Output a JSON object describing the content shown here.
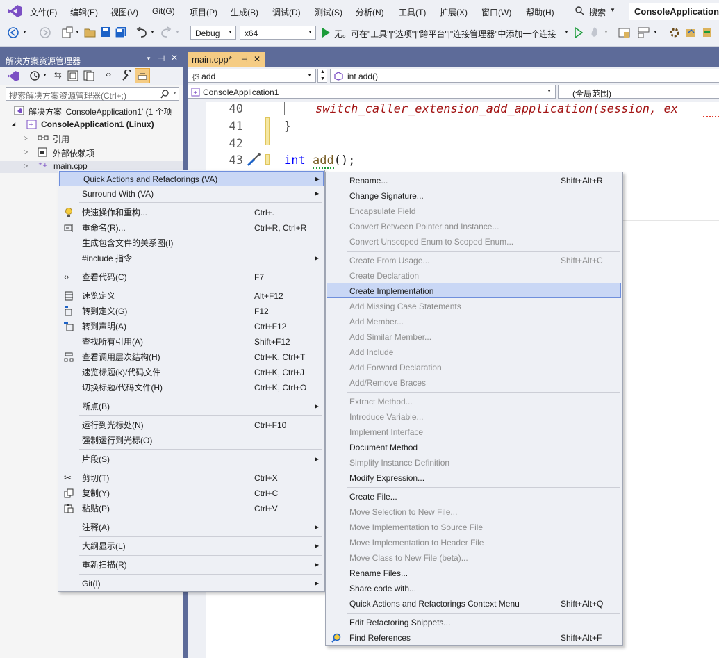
{
  "colors": {
    "accent": "#5d6b99",
    "tab_active": "#f5cc84",
    "menu_bg": "#eef0f5",
    "highlight": "#c9d7f5",
    "disabled_text": "#8d8d8d"
  },
  "menubar": {
    "items": [
      "文件(F)",
      "编辑(E)",
      "视图(V)",
      "Git(G)",
      "项目(P)",
      "生成(B)",
      "调试(D)",
      "测试(S)",
      "分析(N)",
      "工具(T)",
      "扩展(X)",
      "窗口(W)",
      "帮助(H)"
    ],
    "search_label": "搜索",
    "app_title": "ConsoleApplication"
  },
  "toolbar": {
    "config": "Debug",
    "platform": "x64",
    "run_label": "无。可在\"工具\"|\"选项\"|\"跨平台\"|\"连接管理器\"中添加一个连接"
  },
  "solution_explorer": {
    "title": "解决方案资源管理器",
    "search_placeholder": "搜索解决方案资源管理器(Ctrl+;)",
    "tree": [
      {
        "label": "解决方案 'ConsoleApplication1' (1 个项",
        "icon": "solution-icon"
      },
      {
        "label": "ConsoleApplication1 (Linux)",
        "icon": "project-icon"
      },
      {
        "label": "引用",
        "icon": "references-icon"
      },
      {
        "label": "外部依赖项",
        "icon": "dependencies-icon"
      },
      {
        "label": "main.cpp",
        "icon": "cpp-file-icon"
      }
    ]
  },
  "editor": {
    "tab_label": "main.cpp*",
    "scope_function": "add",
    "scope_signature": "int add()",
    "project_combo": "ConsoleApplication1",
    "global_scope": "(全局范围)",
    "lines": [
      {
        "no": "40",
        "code": "switch_caller_extension_add_application(session, ex"
      },
      {
        "no": "41",
        "code": "}"
      },
      {
        "no": "42",
        "code": ""
      },
      {
        "no": "43",
        "keyword": "int",
        "ident": "add",
        "rest": "();"
      }
    ]
  },
  "context_menu": {
    "items": [
      {
        "label": "Quick Actions and Refactorings (VA)",
        "shortcut": "",
        "sub": true
      },
      {
        "label": "Surround With (VA)",
        "shortcut": "",
        "sub": true
      },
      {
        "label": "快速操作和重构...",
        "shortcut": "Ctrl+.",
        "icon": "lightbulb-icon"
      },
      {
        "label": "重命名(R)...",
        "shortcut": "Ctrl+R, Ctrl+R",
        "icon": "rename-icon"
      },
      {
        "label": "生成包含文件的关系图(I)",
        "shortcut": ""
      },
      {
        "label": "#include 指令",
        "shortcut": "",
        "sub": true
      },
      {
        "label": "查看代码(C)",
        "shortcut": "F7",
        "icon": "code-icon"
      },
      {
        "label": "速览定义",
        "shortcut": "Alt+F12",
        "icon": "peek-icon"
      },
      {
        "label": "转到定义(G)",
        "shortcut": "F12",
        "icon": "goto-definition-icon"
      },
      {
        "label": "转到声明(A)",
        "shortcut": "Ctrl+F12",
        "icon": "goto-declaration-icon"
      },
      {
        "label": "查找所有引用(A)",
        "shortcut": "Shift+F12"
      },
      {
        "label": "查看调用层次结构(H)",
        "shortcut": "Ctrl+K, Ctrl+T",
        "icon": "call-hierarchy-icon"
      },
      {
        "label": "速览标题(k)/代码文件",
        "shortcut": "Ctrl+K, Ctrl+J"
      },
      {
        "label": "切换标题/代码文件(H)",
        "shortcut": "Ctrl+K, Ctrl+O"
      },
      {
        "label": "断点(B)",
        "shortcut": "",
        "sub": true
      },
      {
        "label": "运行到光标处(N)",
        "shortcut": "Ctrl+F10"
      },
      {
        "label": "强制运行到光标(O)",
        "shortcut": ""
      },
      {
        "label": "片段(S)",
        "shortcut": "",
        "sub": true
      },
      {
        "label": "剪切(T)",
        "shortcut": "Ctrl+X",
        "icon": "scissors-icon"
      },
      {
        "label": "复制(Y)",
        "shortcut": "Ctrl+C",
        "icon": "copy-icon"
      },
      {
        "label": "粘贴(P)",
        "shortcut": "Ctrl+V",
        "icon": "paste-icon"
      },
      {
        "label": "注释(A)",
        "shortcut": "",
        "sub": true
      },
      {
        "label": "大纲显示(L)",
        "shortcut": "",
        "sub": true
      },
      {
        "label": "重新扫描(R)",
        "shortcut": "",
        "sub": true
      },
      {
        "label": "Git(I)",
        "shortcut": "",
        "sub": true
      }
    ]
  },
  "submenu": {
    "items": [
      {
        "label": "Rename...",
        "shortcut": "Shift+Alt+R",
        "enabled": true
      },
      {
        "label": "Change Signature...",
        "shortcut": "",
        "enabled": true
      },
      {
        "label": "Encapsulate Field",
        "shortcut": "",
        "enabled": false
      },
      {
        "label": "Convert Between Pointer and Instance...",
        "shortcut": "",
        "enabled": false
      },
      {
        "label": "Convert Unscoped Enum to Scoped Enum...",
        "shortcut": "",
        "enabled": false
      },
      {
        "label": "Create From Usage...",
        "shortcut": "Shift+Alt+C",
        "enabled": false
      },
      {
        "label": "Create Declaration",
        "shortcut": "",
        "enabled": false
      },
      {
        "label": "Create Implementation",
        "shortcut": "",
        "enabled": true
      },
      {
        "label": "Add Missing Case Statements",
        "shortcut": "",
        "enabled": false
      },
      {
        "label": "Add Member...",
        "shortcut": "",
        "enabled": false
      },
      {
        "label": "Add Similar Member...",
        "shortcut": "",
        "enabled": false
      },
      {
        "label": "Add Include",
        "shortcut": "",
        "enabled": false
      },
      {
        "label": "Add Forward Declaration",
        "shortcut": "",
        "enabled": false
      },
      {
        "label": "Add/Remove Braces",
        "shortcut": "",
        "enabled": false
      },
      {
        "label": "Extract Method...",
        "shortcut": "",
        "enabled": false
      },
      {
        "label": "Introduce Variable...",
        "shortcut": "",
        "enabled": false
      },
      {
        "label": "Implement Interface",
        "shortcut": "",
        "enabled": false
      },
      {
        "label": "Document Method",
        "shortcut": "",
        "enabled": true
      },
      {
        "label": "Simplify Instance Definition",
        "shortcut": "",
        "enabled": false
      },
      {
        "label": "Modify Expression...",
        "shortcut": "",
        "enabled": true
      },
      {
        "label": "Create File...",
        "shortcut": "",
        "enabled": true
      },
      {
        "label": "Move Selection to New File...",
        "shortcut": "",
        "enabled": false
      },
      {
        "label": "Move Implementation to Source File",
        "shortcut": "",
        "enabled": false
      },
      {
        "label": "Move Implementation to Header File",
        "shortcut": "",
        "enabled": false
      },
      {
        "label": "Move Class to New File (beta)...",
        "shortcut": "",
        "enabled": false
      },
      {
        "label": "Rename Files...",
        "shortcut": "",
        "enabled": true
      },
      {
        "label": "Share code with...",
        "shortcut": "",
        "enabled": true
      },
      {
        "label": "Quick Actions and Refactorings Context Menu",
        "shortcut": "Shift+Alt+Q",
        "enabled": true
      },
      {
        "label": "Edit Refactoring Snippets...",
        "shortcut": "",
        "enabled": true
      },
      {
        "label": "Find References",
        "shortcut": "Shift+Alt+F",
        "enabled": true,
        "icon": "find-references-icon"
      }
    ]
  }
}
